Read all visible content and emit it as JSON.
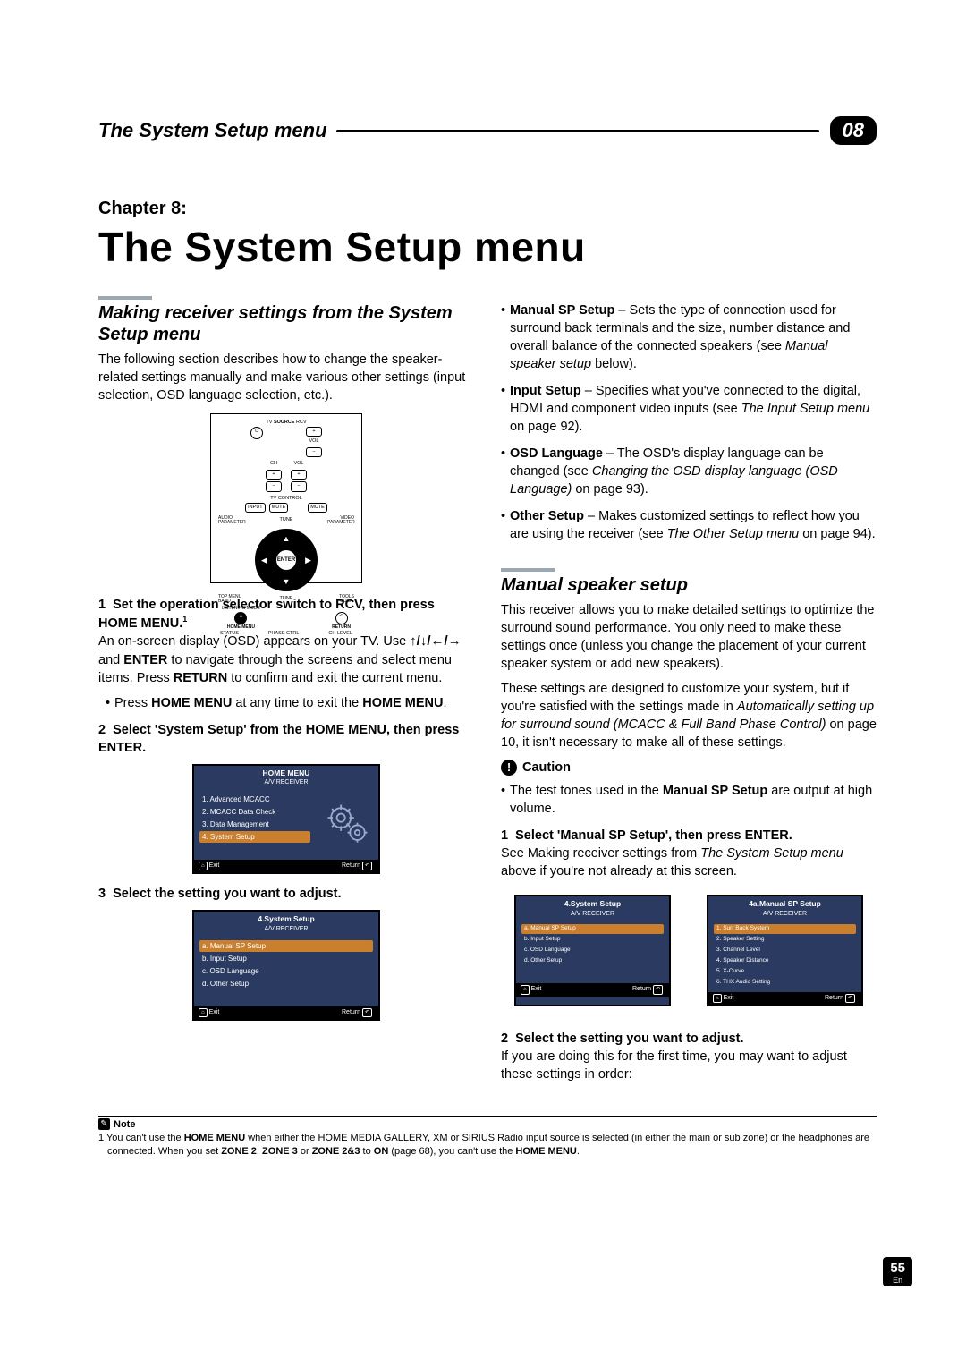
{
  "header": {
    "title": "The System Setup menu",
    "chapter_badge": "08"
  },
  "chapter": {
    "label": "Chapter 8:",
    "title": "The System Setup menu"
  },
  "left": {
    "sec1_title": "Making receiver settings from the System Setup menu",
    "sec1_body": "The following section describes how to change the speaker-related settings manually and make various other settings (input selection, OSD language selection, etc.).",
    "step1_num": "1",
    "step1_lbl": "Set the operation selector switch to RCV, then press HOME MENU.",
    "step1_sup": "1",
    "step1_p1a": "An on-screen display (OSD) appears on your TV. Use ",
    "step1_arrows": "↑/↓/←/→",
    "step1_p1b": " and ",
    "step1_enter": "ENTER",
    "step1_p1c": " to navigate through the screens and select menu items. Press ",
    "step1_return": "RETURN",
    "step1_p1d": " to confirm and exit the current menu.",
    "step1_bullet_a": "Press ",
    "step1_bullet_hm": "HOME MENU",
    "step1_bullet_b": " at any time to exit the ",
    "step1_bullet_hm2": "HOME MENU",
    "step1_bullet_c": ".",
    "step2_num": "2",
    "step2_lbl": "Select 'System Setup' from the HOME MENU, then press ENTER.",
    "step3_num": "3",
    "step3_lbl": "Select the setting you want to adjust."
  },
  "right": {
    "b1_t": "Manual SP Setup",
    "b1_r": " – Sets the type of connection used for surround back terminals and the size, number distance and overall balance of the connected speakers (see ",
    "b1_i": "Manual speaker setup",
    "b1_r2": " below).",
    "b2_t": "Input Setup",
    "b2_r": " – Specifies what you've connected to the digital, HDMI and component video inputs (see ",
    "b2_i": "The Input Setup menu",
    "b2_r2": " on page 92).",
    "b3_t": "OSD Language",
    "b3_r": " – The OSD's display language can be changed (see ",
    "b3_i": "Changing the OSD display language (OSD Language)",
    "b3_r2": " on page 93).",
    "b4_t": "Other Setup",
    "b4_r": " – Makes customized settings to reflect how you are using the receiver (see ",
    "b4_i": "The Other Setup menu",
    "b4_r2": " on page 94).",
    "sec2_title": "Manual speaker setup",
    "sec2_p1": "This receiver allows you to make detailed settings to optimize the surround sound performance. You only need to make these settings once (unless you change the placement of your current speaker system or add new speakers).",
    "sec2_p2a": "These settings are designed to customize your system, but if you're satisfied with the settings made in ",
    "sec2_p2i": "Automatically setting up for surround sound (MCACC & Full Band Phase Control)",
    "sec2_p2b": " on page 10, it isn't necessary to make all of these settings.",
    "caution": "Caution",
    "caution_b_a": "The test tones used in the ",
    "caution_b_bold": "Manual SP Setup",
    "caution_b_b": " are output at high volume.",
    "r_step1_num": "1",
    "r_step1_lbl": "Select 'Manual SP Setup', then press ENTER.",
    "r_step1_p_a": "See Making receiver settings from ",
    "r_step1_p_i": "The System Setup menu",
    "r_step1_p_b": " above if you're not already at this screen.",
    "r_step2_num": "2",
    "r_step2_lbl": "Select the setting you want to adjust.",
    "r_step2_p": "If you are doing this for the first time, you may want to adjust these settings in order:"
  },
  "osd": {
    "home": {
      "title": "HOME MENU",
      "sub": "A/V RECEIVER",
      "items": [
        "1. Advanced MCACC",
        "2. MCACC Data Check",
        "3. Data Management",
        "4. System Setup"
      ],
      "hl": 3,
      "exit": "Exit",
      "return": "Return"
    },
    "system": {
      "title": "4.System Setup",
      "sub": "A/V RECEIVER",
      "items": [
        "a. Manual SP Setup",
        "b. Input Setup",
        "c. OSD Language",
        "d. Other Setup"
      ],
      "hl": 0,
      "exit": "Exit",
      "return": "Return"
    },
    "system2": {
      "title": "4.System Setup",
      "sub": "A/V RECEIVER",
      "items": [
        "a. Manual SP Setup",
        "b. Input Setup",
        "c. OSD Language",
        "d. Other Setup"
      ],
      "hl": 0,
      "exit": "Exit",
      "return": "Return"
    },
    "manual": {
      "title": "4a.Manual SP Setup",
      "sub": "A/V RECEIVER",
      "items": [
        "1. Surr Back System",
        "2. Speaker Setting",
        "3. Channel Level",
        "4. Speaker Distance",
        "5. X-Curve",
        "6. THX Audio Setting"
      ],
      "hl": 0,
      "exit": "Exit",
      "return": "Return"
    }
  },
  "remote": {
    "top": "SOURCE",
    "tv": "TV",
    "rcv": "RCV",
    "r1": [
      "⏻",
      "CH",
      "VOL",
      "VOL"
    ],
    "r2": [
      "+",
      "+",
      "+"
    ],
    "r3": [
      "−",
      "−",
      "−"
    ],
    "tvc": "TV CONTROL",
    "r4": [
      "INPUT",
      "MUTE",
      "MUTE"
    ],
    "dial_center": "ENTER",
    "side_l": [
      "AUDIO PARAMETER",
      "TOP MENU",
      "BAND"
    ],
    "side_r": [
      "VIDEO PARAMETER",
      "TOOLS GUIDE"
    ],
    "tune": "TUNE",
    "bl": "HOME MENU",
    "br": "RETURN",
    "foot": [
      "STATUS",
      "PHASE CTRL",
      "CH LEVEL"
    ],
    "listen": "LISTENING MODE"
  },
  "footnote": {
    "note_label": "Note",
    "text_a": "1 You can't use the ",
    "hm": "HOME MENU",
    "text_b": " when either the HOME MEDIA GALLERY, XM or SIRIUS Radio input source is selected (in either the main or sub zone) or the headphones are connected. When you set ",
    "z2": "ZONE 2",
    "comma1": ", ",
    "z3": "ZONE 3",
    "or": " or ",
    "z23": "ZONE 2&3",
    "to": " to ",
    "on": "ON",
    "text_c": " (page 68), you can't use the ",
    "hm2": "HOME MENU",
    "text_d": "."
  },
  "page": {
    "num": "55",
    "lang": "En"
  }
}
